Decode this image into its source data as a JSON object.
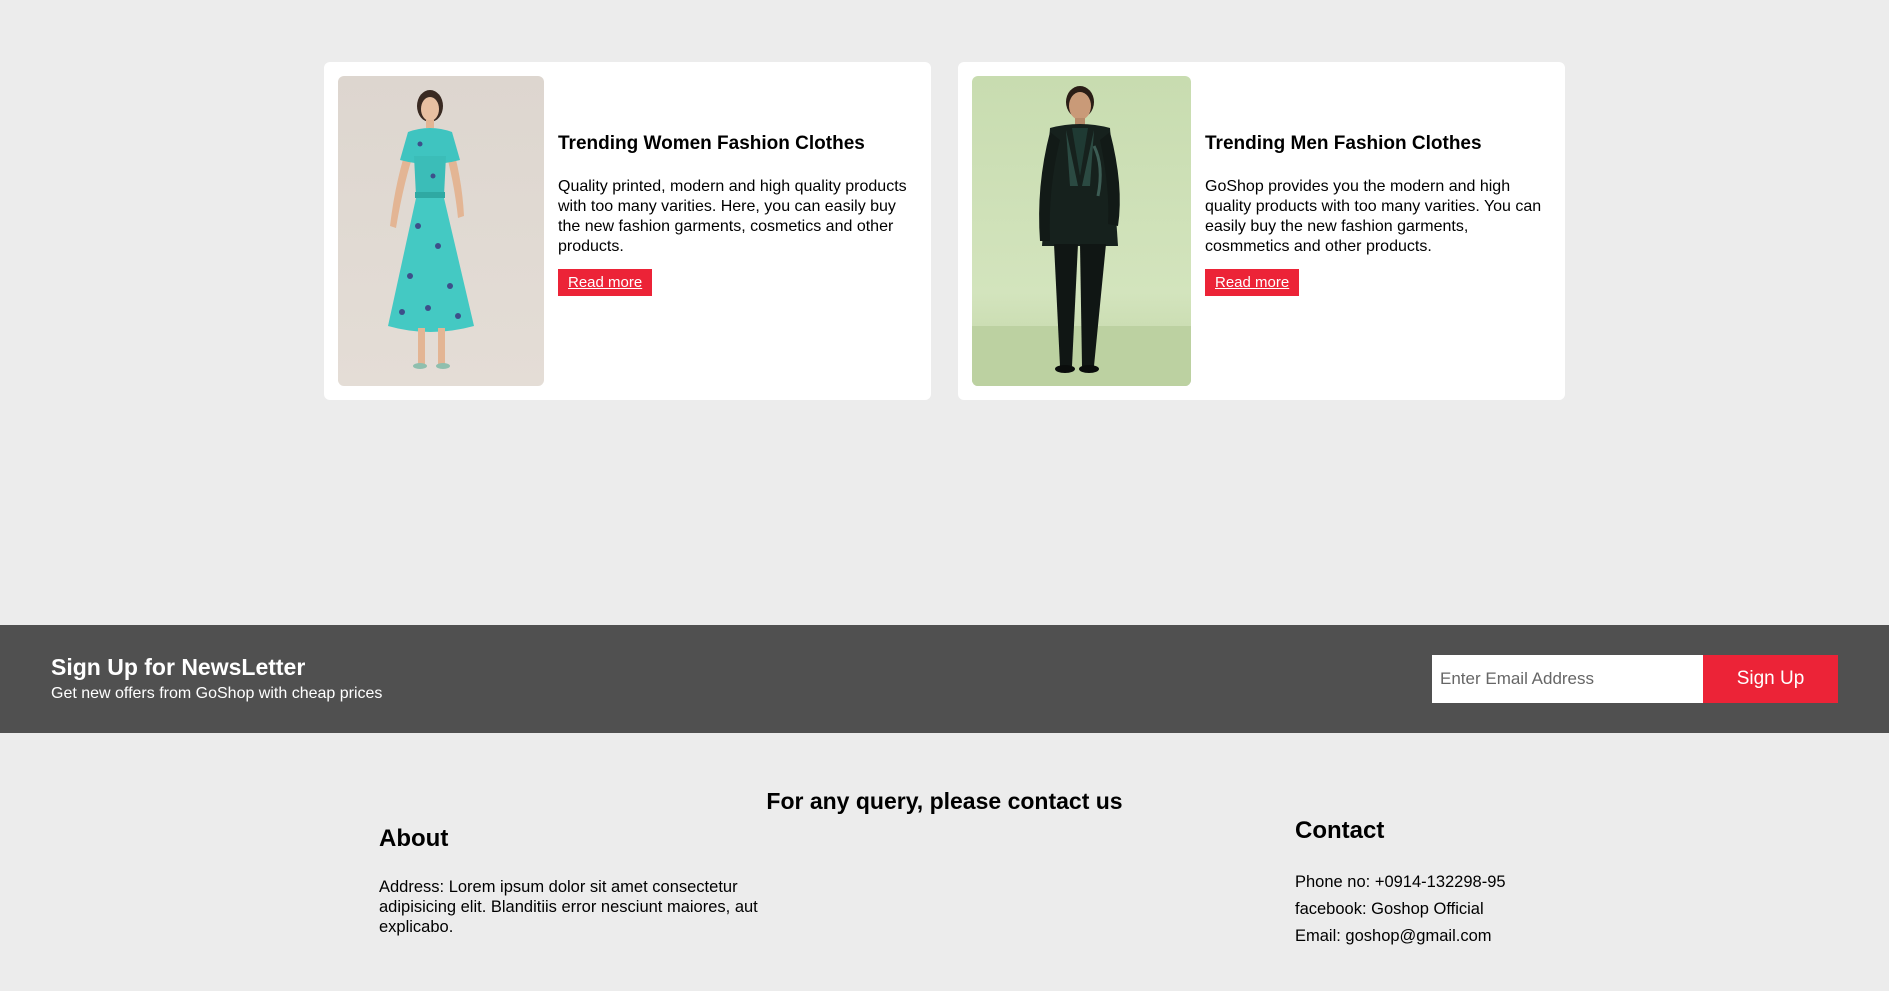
{
  "cards": [
    {
      "title": "Trending Women Fashion Clothes",
      "text": "Quality printed, modern and high quality products with too many varities. Here, you can easily buy the new fashion garments, cosmetics and other products.",
      "button": "Read more"
    },
    {
      "title": "Trending Men Fashion Clothes",
      "text": "GoShop provides you the modern and high quality products with too many varities. You can easily buy the new fashion garments, cosmmetics and other products.",
      "button": "Read more"
    }
  ],
  "newsletter": {
    "title": "Sign Up for NewsLetter",
    "subtitle": "Get new offers from GoShop with cheap prices",
    "placeholder": "Enter Email Address",
    "button": "Sign Up"
  },
  "footer": {
    "heading": "For any query, please contact us",
    "about": {
      "title": "About",
      "text": "Address: Lorem ipsum dolor sit amet consectetur adipisicing elit. Blanditiis error nesciunt maiores, aut explicabo."
    },
    "contact": {
      "title": "Contact",
      "phone": "Phone no: +0914-132298-95",
      "facebook": "facebook: Goshop Official",
      "email": "Email: goshop@gmail.com"
    }
  },
  "colors": {
    "background": "#ececec",
    "accent": "#ec2337",
    "newsletter_bg": "#505050",
    "card_bg": "#ffffff"
  }
}
